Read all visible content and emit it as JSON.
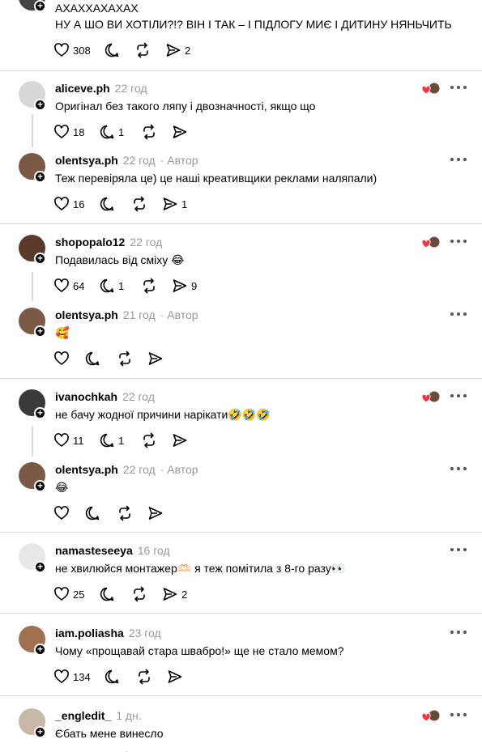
{
  "post": {
    "line1": "АХАХХАХАХАХ",
    "line2": "НУ А ШО ВИ ХОТІЛИ?!? ВІН І ТАК – І ПІДЛОГУ МИЄ І ДИТИНУ НЯНЬЧИТЬ",
    "likes": "308",
    "shares": "2"
  },
  "comments": [
    {
      "user": "aliceve.ph",
      "time": "22 год",
      "author": "",
      "text": "Оригінал без такого ляпу і двозначності, якщо що",
      "likes": "18",
      "replies": "1",
      "reposts": "",
      "shares": ""
    },
    {
      "user": "olentsya.ph",
      "time": "22 год",
      "author": "· Автор",
      "text": "Теж перевіряла це) це наші креативщики реклами наляпали)",
      "likes": "16",
      "replies": "",
      "reposts": "",
      "shares": "1"
    },
    {
      "user": "shopopalo12",
      "time": "22 год",
      "author": "",
      "text": "Подавилась від сміху 😂",
      "likes": "64",
      "replies": "1",
      "reposts": "",
      "shares": "9"
    },
    {
      "user": "olentsya.ph",
      "time": "21 год",
      "author": "· Автор",
      "text": "🥰",
      "likes": "",
      "replies": "",
      "reposts": "",
      "shares": ""
    },
    {
      "user": "ivanochkah",
      "time": "22 год",
      "author": "",
      "text": "не бачу жодної причини нарікати🤣🤣🤣",
      "likes": "11",
      "replies": "1",
      "reposts": "",
      "shares": ""
    },
    {
      "user": "olentsya.ph",
      "time": "22 год",
      "author": "· Автор",
      "text": "😂",
      "likes": "",
      "replies": "",
      "reposts": "",
      "shares": ""
    },
    {
      "user": "namasteseeya",
      "time": "16 год",
      "author": "",
      "text": "не хвилюйся монтажер🫶🏻 я теж помітила з 8-го разу👀",
      "likes": "25",
      "replies": "",
      "reposts": "",
      "shares": "2"
    },
    {
      "user": "iam.poliasha",
      "time": "23 год",
      "author": "",
      "text": "Чому «прощавай стара швабро!» ще не стало мемом?",
      "likes": "134",
      "replies": "",
      "reposts": "",
      "shares": ""
    },
    {
      "user": "_engledit_",
      "time": "1 дн.",
      "author": "",
      "text": "Єбать мене винесло",
      "likes": "",
      "replies": "",
      "reposts": "",
      "shares": ""
    }
  ],
  "colors": {
    "separator": "#d9d9d9",
    "meta": "#999999",
    "heart": "#ff3040"
  },
  "icons": [
    "heart-icon",
    "comment-icon",
    "repost-icon",
    "share-icon",
    "more-icon",
    "plus-icon",
    "liked-by-author-icon"
  ]
}
